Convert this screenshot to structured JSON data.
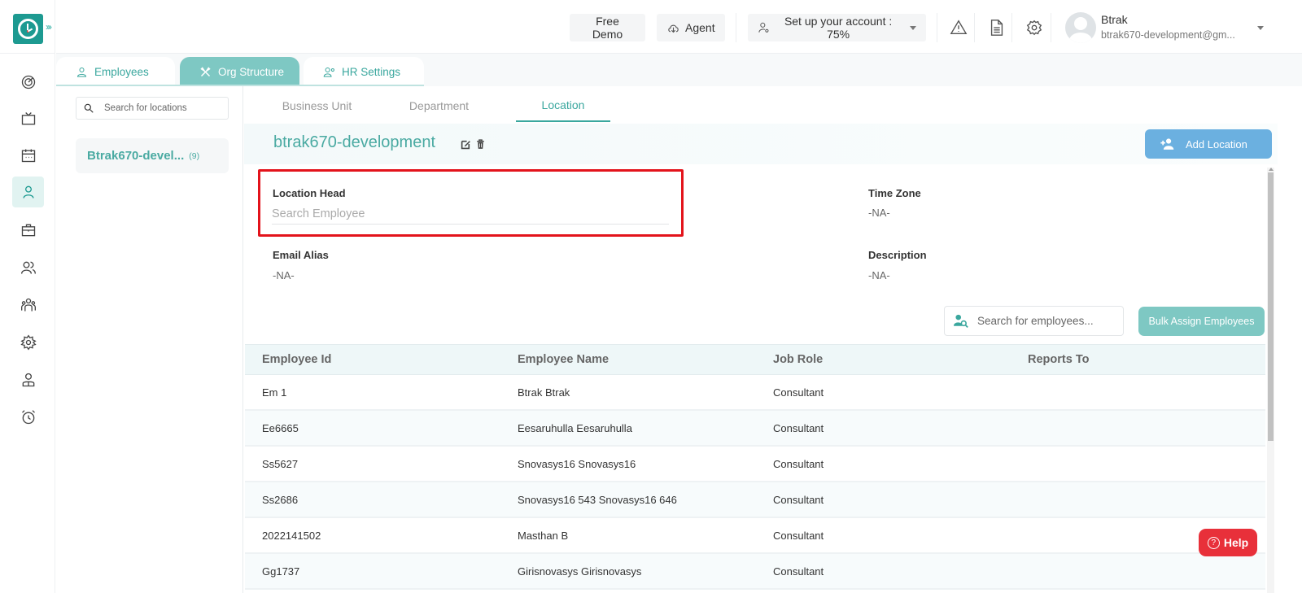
{
  "header": {
    "free_demo": "Free Demo",
    "agent": "Agent",
    "setup_account": "Set up your account : 75%",
    "user_name": "Btrak",
    "user_email": "btrak670-development@gm..."
  },
  "sidebar": {
    "items": [
      {
        "icon": "dashboard-icon"
      },
      {
        "icon": "tv-icon"
      },
      {
        "icon": "calendar-icon"
      },
      {
        "icon": "user-icon",
        "active": true
      },
      {
        "icon": "briefcase-icon"
      },
      {
        "icon": "users-icon"
      },
      {
        "icon": "team-icon"
      },
      {
        "icon": "settings-icon"
      },
      {
        "icon": "employee-icon"
      },
      {
        "icon": "alarm-icon"
      }
    ]
  },
  "top_tabs": [
    {
      "label": "Employees",
      "active": false
    },
    {
      "label": "Org Structure",
      "active": true
    },
    {
      "label": "HR Settings",
      "active": false
    }
  ],
  "locations_panel": {
    "search_placeholder": "Search for locations",
    "items": [
      {
        "name": "Btrak670-devel...",
        "count": "(9)"
      }
    ]
  },
  "sub_tabs": [
    {
      "label": "Business Unit",
      "active": false
    },
    {
      "label": "Department",
      "active": false
    },
    {
      "label": "Location",
      "active": true
    }
  ],
  "location": {
    "title": "btrak670-development",
    "add_location_label": "Add Location",
    "fields": {
      "location_head_label": "Location Head",
      "location_head_placeholder": "Search Employee",
      "time_zone_label": "Time Zone",
      "time_zone_value": "-NA-",
      "email_alias_label": "Email Alias",
      "email_alias_value": "-NA-",
      "description_label": "Description",
      "description_value": "-NA-"
    }
  },
  "employees": {
    "search_placeholder": "Search for employees...",
    "bulk_assign_label": "Bulk Assign Employees",
    "columns": [
      "Employee Id",
      "Employee Name",
      "Job Role",
      "Reports To"
    ],
    "rows": [
      [
        "Em 1",
        "Btrak Btrak",
        "Consultant",
        ""
      ],
      [
        "Ee6665",
        "Eesaruhulla Eesaruhulla",
        "Consultant",
        ""
      ],
      [
        "Ss5627",
        "Snovasys16 Snovasys16",
        "Consultant",
        ""
      ],
      [
        "Ss2686",
        "Snovasys16 543 Snovasys16 646",
        "Consultant",
        ""
      ],
      [
        "2022141502",
        "Masthan B",
        "Consultant",
        ""
      ],
      [
        "Gg1737",
        "Girisnovasys Girisnovasys",
        "Consultant",
        ""
      ]
    ]
  },
  "help_label": "Help",
  "colors": {
    "brand": "#1d9a91",
    "accent": "#4aaaa2",
    "active_tab": "#7ec8c3",
    "add_button": "#6bb0e0",
    "highlight": "#e3131b",
    "help": "#e8303a"
  }
}
